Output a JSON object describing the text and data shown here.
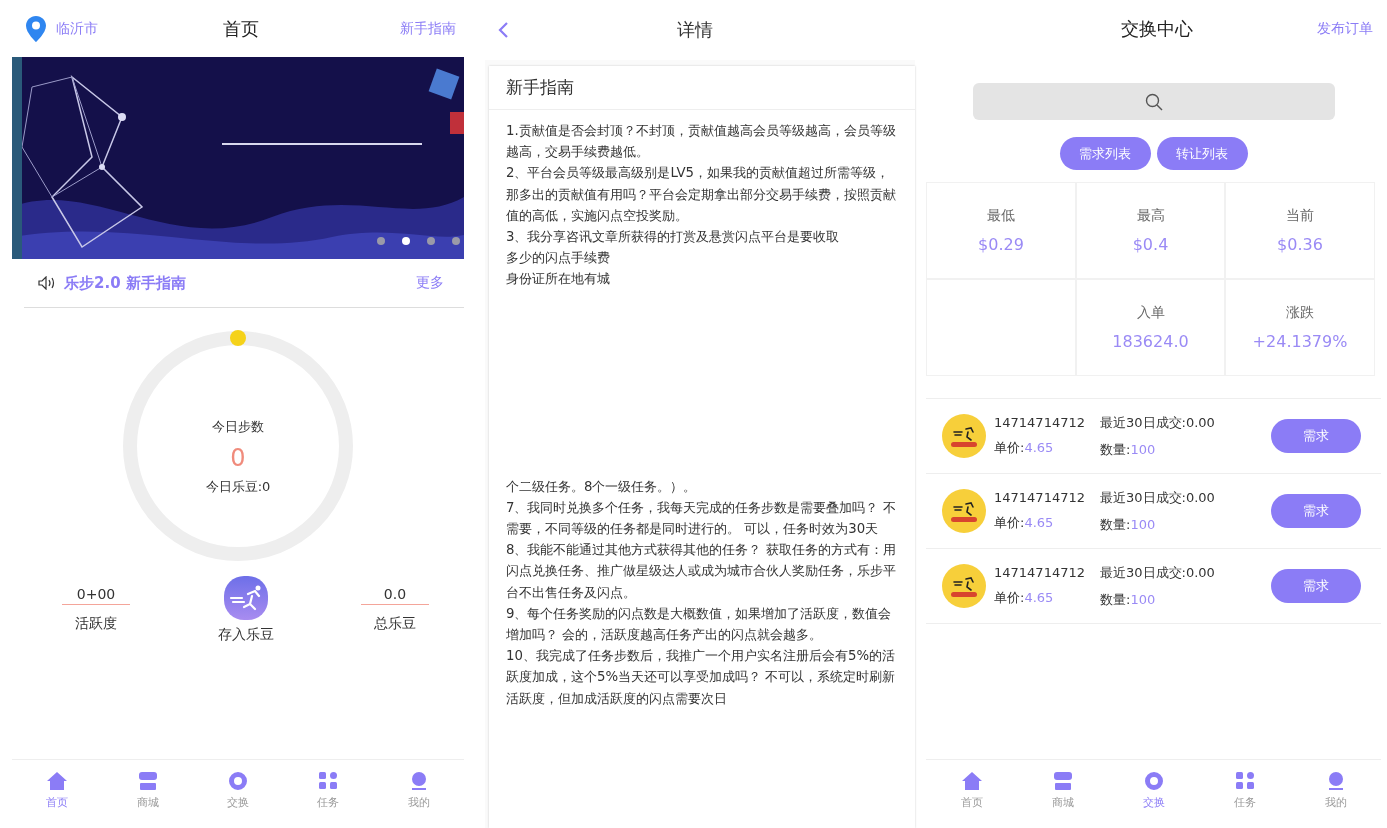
{
  "home": {
    "location": "临沂市",
    "title": "首页",
    "link": "新手指南",
    "banner": {
      "kind": "picture",
      "dots": [
        {
          "selected": false
        },
        {
          "selected": true
        },
        {
          "selected": false
        },
        {
          "selected": false
        }
      ]
    },
    "notice": {
      "title": "乐步2.0 新手指南",
      "more": "更多"
    },
    "steps": {
      "label": "今日步数",
      "value": "0",
      "beans": "今日乐豆:0"
    },
    "stats": [
      {
        "value": "0+00",
        "label": "活跃度"
      },
      {
        "value": "0.0",
        "label": "总乐豆"
      }
    ],
    "deposit": "存入乐豆",
    "nav": [
      {
        "label": "首页",
        "selected": true
      },
      {
        "label": "商城",
        "selected": false
      },
      {
        "label": "交换",
        "selected": false
      },
      {
        "label": "任务",
        "selected": false
      },
      {
        "label": "我的",
        "selected": false
      }
    ]
  },
  "detail": {
    "title": "详情",
    "card_title": "新手指南",
    "upper": [
      "1.贡献值是否会封顶？不封顶，贡献值越高会员等级越高，会员等级越高，交易手续费越低。",
      "2、平台会员等级最高级别是LV5，如果我的贡献值超过所需等级，那多出的贡献值有用吗？平台会定期拿出部分交易手续费，按照贡献值的高低，实施闪点空投奖励。",
      "3、我分享咨讯文章所获得的打赏及悬赏闪点平台是要收取",
      "多少的闪点手续费",
      "身份证所在地有城"
    ],
    "lower": [
      "个二级任务。8个一级任务。）。",
      "7、我同时兑换多个任务，我每天完成的任务步数是需要叠加吗？ 不需要，不同等级的任务都是同时进行的。 可以，任务时效为30天",
      "8、我能不能通过其他方式获得其他的任务？ 获取任务的方式有：用闪点兑换任务、推广做星级达人或成为城市合伙人奖励任务，乐步平台不出售任务及闪点。",
      "9、每个任务奖励的闪点数是大概数值，如果增加了活跃度，数值会增加吗？ 会的，活跃度越高任务产出的闪点就会越多。",
      "10、我完成了任务步数后，我推广一个用户实名注册后会有5%的活跃度加成，这个5%当天还可以享受加成吗？ 不可以，系统定时刷新活跃度，但加成活跃度的闪点需要次日"
    ]
  },
  "exchange": {
    "title": "交换中心",
    "link": "发布订单",
    "tabs": [
      {
        "label": "需求列表"
      },
      {
        "label": "转让列表"
      }
    ],
    "market": [
      {
        "kind": "stat",
        "label": "最低",
        "value": "$0.29"
      },
      {
        "kind": "stat",
        "label": "最高",
        "value": "$0.4"
      },
      {
        "kind": "stat",
        "label": "当前",
        "value": "$0.36"
      },
      {
        "kind": "blank"
      },
      {
        "kind": "stat",
        "label": "入单",
        "value": "183624.0"
      },
      {
        "kind": "stat",
        "label": "涨跌",
        "value": "+24.1379%"
      }
    ],
    "orders": [
      {
        "name": "14714714712",
        "price_label": "单价:",
        "price": "4.65",
        "deal": "最近30日成交:0.00",
        "qty_label": "数量:",
        "qty": "100",
        "action": "需求"
      },
      {
        "name": "14714714712",
        "price_label": "单价:",
        "price": "4.65",
        "deal": "最近30日成交:0.00",
        "qty_label": "数量:",
        "qty": "100",
        "action": "需求"
      },
      {
        "name": "14714714712",
        "price_label": "单价:",
        "price": "4.65",
        "deal": "最近30日成交:0.00",
        "qty_label": "数量:",
        "qty": "100",
        "action": "需求"
      }
    ],
    "nav": [
      {
        "label": "首页",
        "selected": false
      },
      {
        "label": "商城",
        "selected": false
      },
      {
        "label": "交换",
        "selected": true
      },
      {
        "label": "任务",
        "selected": false
      },
      {
        "label": "我的",
        "selected": false
      }
    ]
  }
}
